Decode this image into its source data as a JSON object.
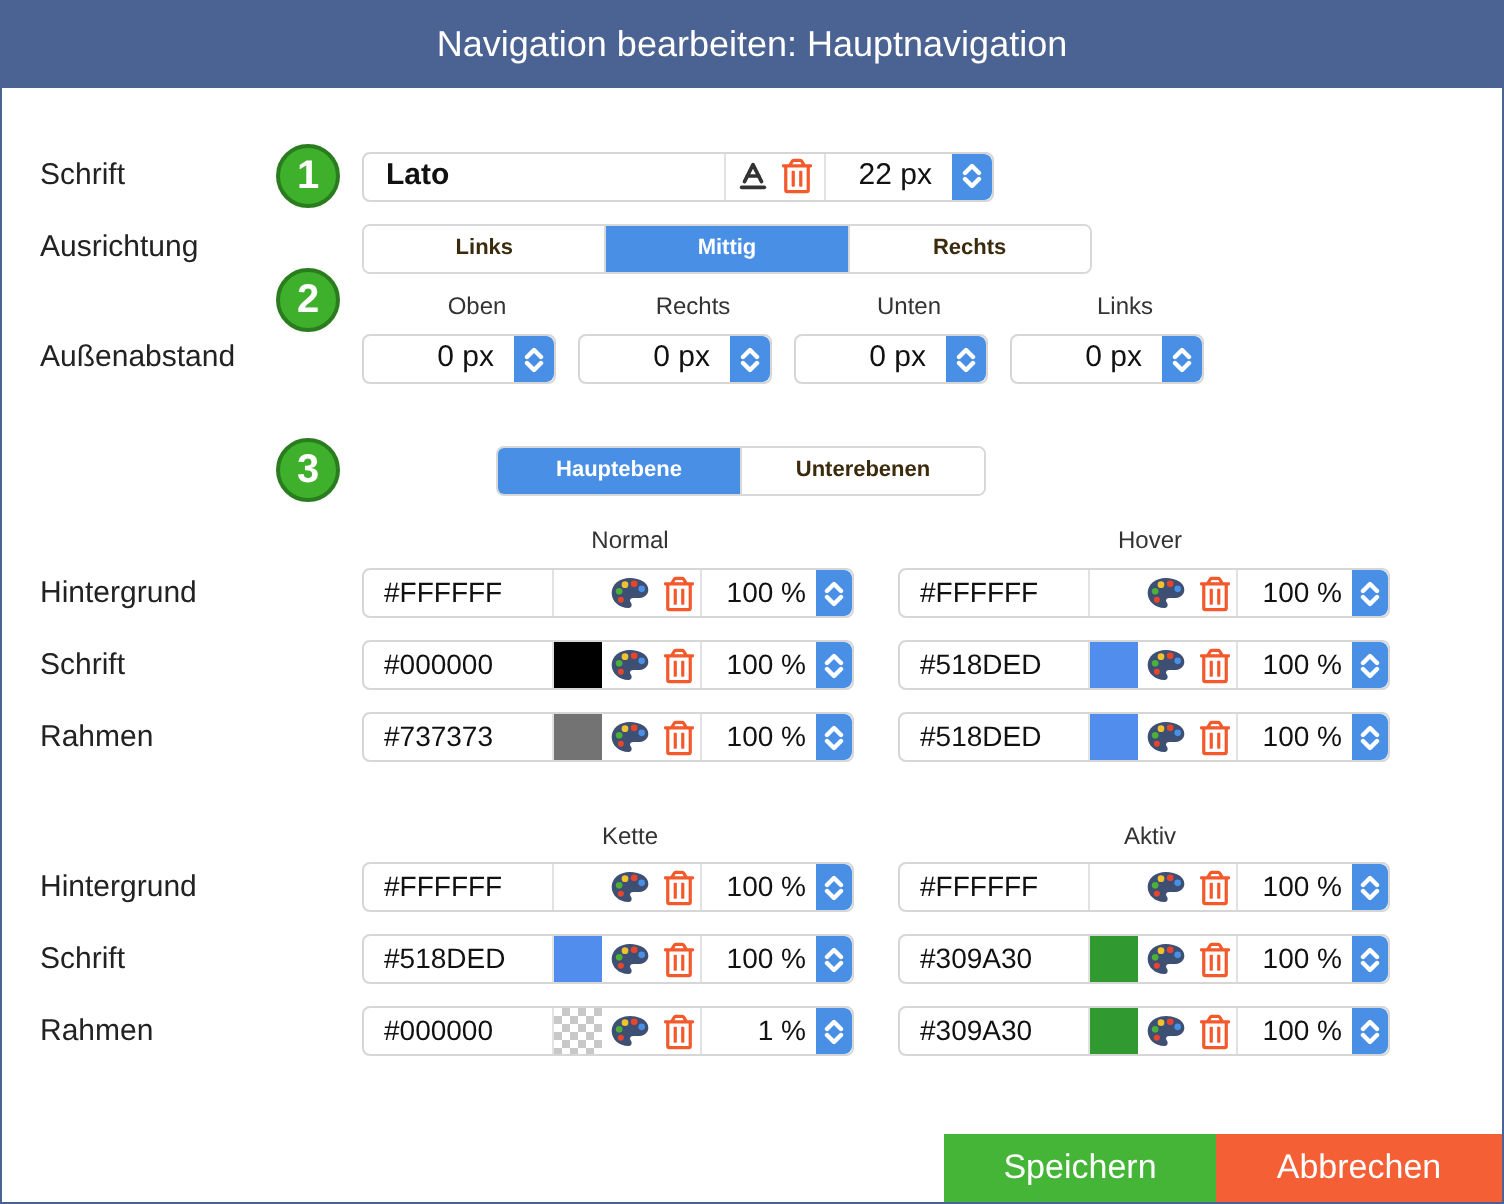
{
  "window": {
    "title": "Navigation bearbeiten: Hauptnavigation"
  },
  "font": {
    "label": "Schrift",
    "step": "1",
    "family": "Lato",
    "size": "22",
    "unit": "px"
  },
  "alignment": {
    "label": "Ausrichtung",
    "options": [
      {
        "label": "Links",
        "selected": false
      },
      {
        "label": "Mittig",
        "selected": true
      },
      {
        "label": "Rechts",
        "selected": false
      }
    ]
  },
  "margin": {
    "label": "Außenabstand",
    "step": "2",
    "sides": [
      {
        "heading": "Oben",
        "value": "0",
        "unit": "px"
      },
      {
        "heading": "Rechts",
        "value": "0",
        "unit": "px"
      },
      {
        "heading": "Unten",
        "value": "0",
        "unit": "px"
      },
      {
        "heading": "Links",
        "value": "0",
        "unit": "px"
      }
    ]
  },
  "levels": {
    "step": "3",
    "tabs": [
      {
        "label": "Hauptebene",
        "selected": true
      },
      {
        "label": "Unterebenen",
        "selected": false
      }
    ]
  },
  "color_sections": [
    {
      "headings": [
        "Normal",
        "Hover"
      ],
      "rows": [
        {
          "label": "Hintergrund",
          "cells": [
            {
              "hex": "#FFFFFF",
              "transparent": false,
              "opacity": "100",
              "unit": "%"
            },
            {
              "hex": "#FFFFFF",
              "transparent": false,
              "opacity": "100",
              "unit": "%"
            }
          ]
        },
        {
          "label": "Schrift",
          "cells": [
            {
              "hex": "#000000",
              "color": "#000000",
              "transparent": false,
              "opacity": "100",
              "unit": "%"
            },
            {
              "hex": "#518DED",
              "color": "#518ded",
              "transparent": false,
              "opacity": "100",
              "unit": "%"
            }
          ]
        },
        {
          "label": "Rahmen",
          "cells": [
            {
              "hex": "#737373",
              "color": "#737373",
              "transparent": false,
              "opacity": "100",
              "unit": "%"
            },
            {
              "hex": "#518DED",
              "color": "#518ded",
              "transparent": false,
              "opacity": "100",
              "unit": "%"
            }
          ]
        }
      ]
    },
    {
      "headings": [
        "Kette",
        "Aktiv"
      ],
      "rows": [
        {
          "label": "Hintergrund",
          "cells": [
            {
              "hex": "#FFFFFF",
              "transparent": false,
              "opacity": "100",
              "unit": "%"
            },
            {
              "hex": "#FFFFFF",
              "transparent": false,
              "opacity": "100",
              "unit": "%"
            }
          ]
        },
        {
          "label": "Schrift",
          "cells": [
            {
              "hex": "#518DED",
              "color": "#518ded",
              "transparent": false,
              "opacity": "100",
              "unit": "%"
            },
            {
              "hex": "#309A30",
              "color": "#309a30",
              "transparent": false,
              "opacity": "100",
              "unit": "%"
            }
          ]
        },
        {
          "label": "Rahmen",
          "cells": [
            {
              "hex": "#000000",
              "transparent": true,
              "opacity": "1",
              "unit": "%"
            },
            {
              "hex": "#309A30",
              "color": "#309a30",
              "transparent": false,
              "opacity": "100",
              "unit": "%"
            }
          ]
        }
      ]
    }
  ],
  "buttons": [
    {
      "label": "Speichern",
      "kind": "save"
    },
    {
      "label": "Abbrechen",
      "kind": "cancel"
    }
  ]
}
